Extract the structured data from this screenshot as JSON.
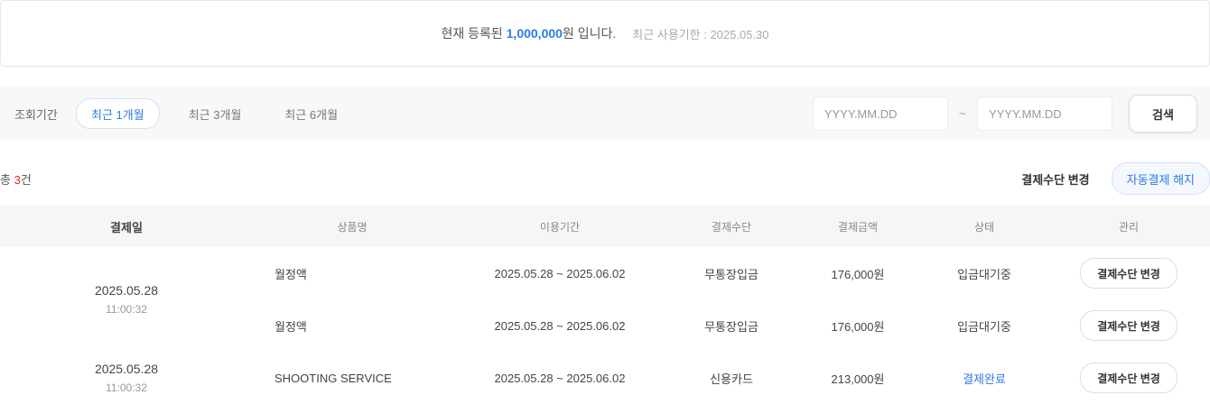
{
  "banner": {
    "prefix": "현재 등록된 ",
    "highlight": "1,000,000",
    "suffix": "원 입니다.",
    "sub": "최근 사용기한 : 2025.05.30"
  },
  "filter": {
    "label": "조회기간",
    "pills": [
      {
        "label": "최근 1개월",
        "active": true
      },
      {
        "label": "최근 3개월",
        "active": false
      },
      {
        "label": "최근 6개월",
        "active": false
      }
    ],
    "start_placeholder": "YYYY.MM.DD",
    "end_placeholder": "YYYY.MM.DD",
    "tilde": "~",
    "search_label": "검색"
  },
  "toolbar": {
    "count_prefix": "총 ",
    "count_value": "3",
    "count_suffix": "건",
    "action1": "결제수단 변경",
    "action2": "자동결제 해지"
  },
  "table": {
    "headers": [
      "결제일",
      "상품명",
      "이용기간",
      "결제수단",
      "결제금액",
      "상태",
      "관리"
    ],
    "rows": [
      {
        "date": "2025.05.28",
        "time": "11:00:32",
        "product": "월정액",
        "period": "2025.05.28 ~ 2025.06.02",
        "method": "무통장입금",
        "amount": "176,000원",
        "status": "입금대기중",
        "button": "결제수단 변경"
      },
      {
        "date": "",
        "time": "",
        "product": "월정액",
        "period": "2025.05.28 ~ 2025.06.02",
        "method": "무통장입금",
        "amount": "176,000원",
        "status": "입금대기중",
        "button": "결제수단 변경"
      },
      {
        "date": "2025.05.28",
        "time": "11:00:32",
        "product": "SHOOTING SERVICE",
        "period": "2025.05.28 ~ 2025.06.02",
        "method": "신용카드",
        "amount": "213,000원",
        "status": "결제완료",
        "button": "결제수단 변경"
      }
    ]
  }
}
